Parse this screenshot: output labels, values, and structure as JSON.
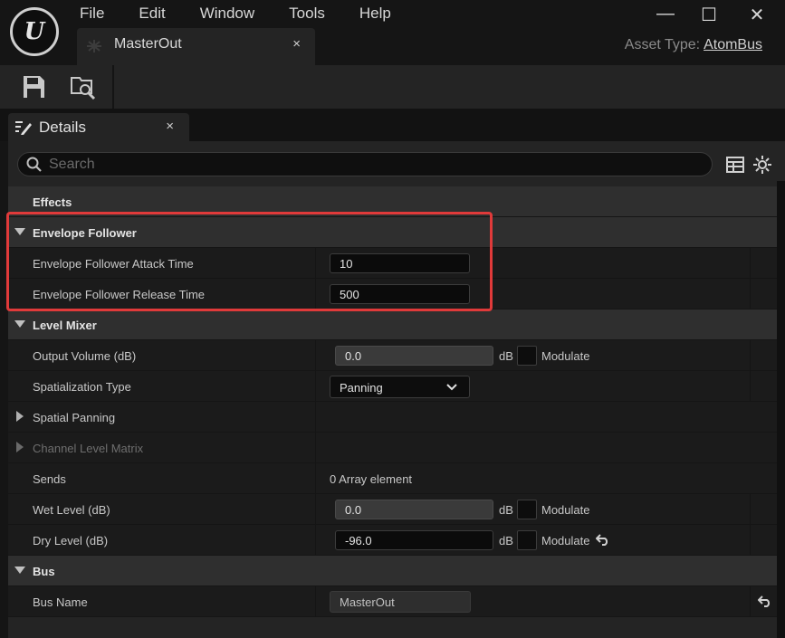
{
  "app": {
    "logo_text": "U",
    "menu": [
      "File",
      "Edit",
      "Window",
      "Tools",
      "Help"
    ],
    "window_controls": {
      "minimize": "—",
      "maximize": "☐",
      "close": "✕"
    }
  },
  "document_tab": {
    "label": "MasterOut",
    "close": "×"
  },
  "asset_type": {
    "label": "Asset Type:",
    "value": "AtomBus"
  },
  "toolbar": {
    "save_icon": "save-icon",
    "browse_icon": "browse-asset-icon"
  },
  "details_tab": {
    "label": "Details",
    "close": "×"
  },
  "search": {
    "placeholder": "Search",
    "value": ""
  },
  "sections": {
    "effects": "Effects",
    "envelope": {
      "title": "Envelope Follower",
      "attack_label": "Envelope Follower Attack Time",
      "attack_value": "10",
      "release_label": "Envelope Follower Release Time",
      "release_value": "500"
    },
    "level_mixer": {
      "title": "Level Mixer",
      "output_volume_label": "Output Volume (dB)",
      "output_volume_value": "0.0",
      "unit": "dB",
      "modulate": "Modulate",
      "spatialization_label": "Spatialization Type",
      "spatialization_value": "Panning",
      "spatial_panning_label": "Spatial Panning",
      "channel_matrix_label": "Channel Level Matrix",
      "sends_label": "Sends",
      "sends_value": "0 Array element",
      "wet_label": "Wet Level (dB)",
      "wet_value": "0.0",
      "dry_label": "Dry Level (dB)",
      "dry_value": "-96.0"
    },
    "bus": {
      "title": "Bus",
      "bus_name_label": "Bus Name",
      "bus_name_value": "MasterOut"
    }
  },
  "colors": {
    "highlight": "#e03a3a",
    "background": "#242424",
    "accent_text": "#cfcfcf"
  }
}
